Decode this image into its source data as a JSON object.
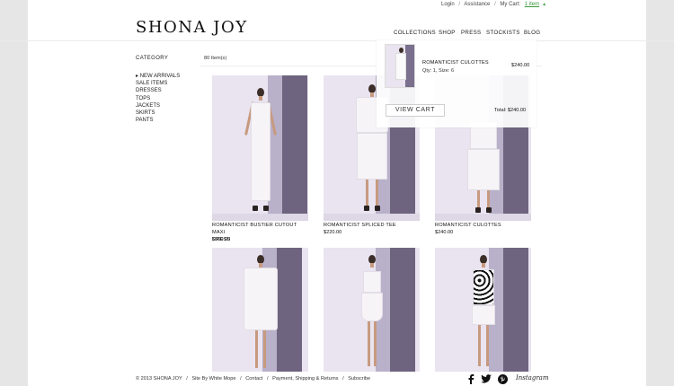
{
  "utility": {
    "login": "Login",
    "assistance": "Assistance",
    "my_cart": "My Cart:",
    "cart_count": "1 item"
  },
  "logo": "SHONA JOY",
  "nav": [
    "COLLECTIONS",
    "SHOP",
    "PRESS",
    "STOCKISTS",
    "BLOG"
  ],
  "sidebar": {
    "title": "CATEGORY",
    "items": [
      "NEW ARRIVALS",
      "SALE ITEMS",
      "DRESSES",
      "TOPS",
      "JACKETS",
      "SKIRTS",
      "PANTS"
    ]
  },
  "results_count": "80 Item(s)",
  "products": [
    {
      "name_line1": "ROMANTICIST BUSTIER CUTOUT MAXI",
      "name_line2": "DRESS",
      "price": "$360.00"
    },
    {
      "name_line1": "ROMANTICIST SPLICED TEE",
      "name_line2": "",
      "price": "$220.00"
    },
    {
      "name_line1": "ROMANTICIST CULOTTES",
      "name_line2": "",
      "price": "$240.00"
    },
    {
      "name_line1": "",
      "name_line2": "",
      "price": ""
    },
    {
      "name_line1": "",
      "name_line2": "",
      "price": ""
    },
    {
      "name_line1": "",
      "name_line2": "",
      "price": ""
    }
  ],
  "cart_dropdown": {
    "item_name": "ROMANTICIST CULOTTES",
    "item_details": "Qty: 1, Size: 6",
    "item_price": "$240.00",
    "view_cart_label": "VIEW CART",
    "total": "Total: $240.00"
  },
  "footer": {
    "copyright": "© 2013 SHONA JOY",
    "site_by": "Site By White Mope",
    "contact": "Contact",
    "payment": "Payment, Shipping & Returns",
    "subscribe": "Subscribe",
    "instagram": "Instagram"
  },
  "icons": [
    "facebook-icon",
    "twitter-icon",
    "pinterest-icon",
    "instagram-icon"
  ],
  "colors": {
    "cart_link": "#3a9a3a",
    "backdrop_wall": "#6f647f",
    "background": "#e6e6e6"
  }
}
